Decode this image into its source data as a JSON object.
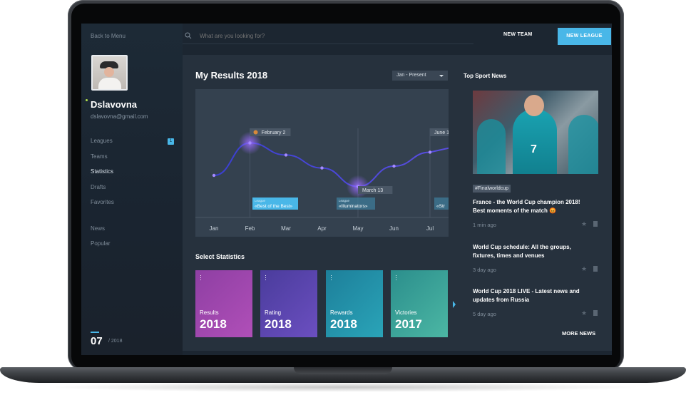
{
  "sidebar": {
    "back_label": "Back to Menu",
    "user": {
      "name": "Dslavovna",
      "email": "dslavovna@gmail.com"
    },
    "nav": [
      {
        "label": "Leagues",
        "badge": "1",
        "active": false
      },
      {
        "label": "Teams",
        "active": false
      },
      {
        "label": "Statistics",
        "active": true
      },
      {
        "label": "Drafts",
        "active": false
      },
      {
        "label": "Favorites",
        "active": false
      }
    ],
    "nav2": [
      {
        "label": "News"
      },
      {
        "label": "Popular"
      }
    ],
    "pager": {
      "current": "07",
      "total": "/ 2018"
    }
  },
  "topbar": {
    "search_placeholder": "What are you looking for?",
    "new_team": "NEW TEAM",
    "new_league": "NEW LEAGUE"
  },
  "main": {
    "title": "My Results 2018",
    "range_select": "Jan - Present",
    "select_stats_title": "Select Statistics",
    "stat_cards": [
      {
        "label": "Results",
        "year": "2018",
        "color_from": "#8e3fa3",
        "color_to": "#b04fb8"
      },
      {
        "label": "Rating",
        "year": "2018",
        "color_from": "#4a3c9c",
        "color_to": "#6b4fc0"
      },
      {
        "label": "Rewards",
        "year": "2018",
        "color_from": "#1d7f9a",
        "color_to": "#2aa4b8"
      },
      {
        "label": "Victories",
        "year": "2017",
        "color_from": "#2b8e8c",
        "color_to": "#4cb7a4"
      }
    ]
  },
  "chart_data": {
    "type": "line",
    "x": [
      "Jan",
      "Feb",
      "Mar",
      "Apr",
      "May",
      "Jun",
      "Jul"
    ],
    "series": [
      {
        "values": [
          0.3,
          0.65,
          0.52,
          0.38,
          0.18,
          0.4,
          0.55
        ]
      }
    ],
    "annotations": [
      {
        "label": "February 2",
        "at": "Feb"
      },
      {
        "label": "March 13",
        "at": "May"
      },
      {
        "label": "June 1",
        "at": "Jul"
      }
    ],
    "callouts": [
      {
        "small": "League",
        "text": "«Best of the Best»"
      },
      {
        "small": "League",
        "text": "«Illuminators»"
      },
      {
        "small": "",
        "text": "«Str"
      }
    ],
    "accent_color": "#5b4fe0",
    "glow_color": "#9a6bff"
  },
  "news": {
    "title": "Top Sport News",
    "image_number": "7",
    "tag": "#Finalworldcup",
    "items": [
      {
        "headline": "France - the World Cup champion 2018! Best moments of the match",
        "emoji": "😡",
        "ago": "1 min ago"
      },
      {
        "headline": "World Cup schedule: All the groups, fixtures, times and venues",
        "ago": "3 day ago"
      },
      {
        "headline": "World Cup 2018 LIVE - Latest news and updates from Russia",
        "ago": "5 day ago"
      }
    ],
    "more_label": "MORE NEWS"
  }
}
